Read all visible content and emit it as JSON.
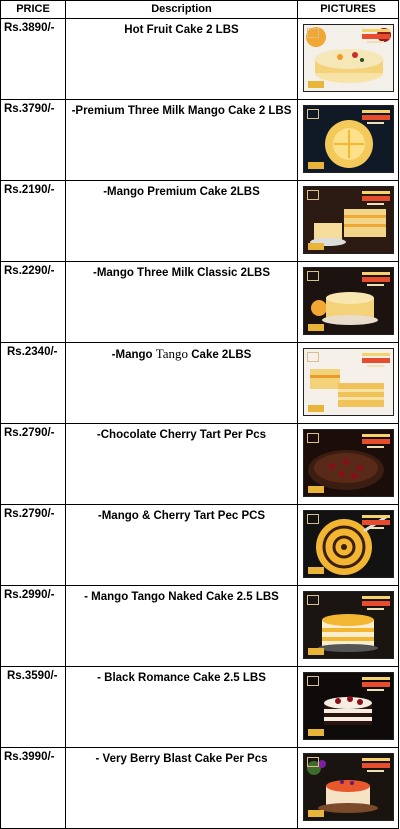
{
  "table": {
    "headers": {
      "price": "PRICE",
      "description": "Description",
      "pictures": "PICTURES"
    },
    "rows": [
      {
        "price": "Rs.3890/-",
        "description": "Hot Fruit Cake 2 LBS",
        "picture_icon": "cake-photo-icon"
      },
      {
        "price": "Rs.3790/-",
        "description": "-Premium Three Milk Mango Cake 2 LBS",
        "picture_icon": "cake-photo-icon"
      },
      {
        "price": "Rs.2190/-",
        "description": "-Mango Premium Cake  2LBS",
        "picture_icon": "cake-photo-icon"
      },
      {
        "price": "Rs.2290/-",
        "description": "-Mango Three Milk Classic 2LBS",
        "picture_icon": "cake-photo-icon"
      },
      {
        "price": "Rs.2340/-",
        "description_parts": [
          "-Mango ",
          "Tango",
          " Cake 2LBS"
        ],
        "picture_icon": "cake-photo-icon"
      },
      {
        "price": "Rs.2790/-",
        "description": "-Chocolate Cherry Tart  Per Pcs",
        "picture_icon": "tart-photo-icon"
      },
      {
        "price": "Rs.2790/-",
        "description": "-Mango & Cherry Tart Pec PCS",
        "picture_icon": "tart-photo-icon"
      },
      {
        "price": "Rs.2990/-",
        "description": "- Mango Tango Naked Cake 2.5 LBS",
        "picture_icon": "cake-photo-icon"
      },
      {
        "price": "Rs.3590/-",
        "description": "- Black Romance Cake 2.5 LBS",
        "picture_icon": "cake-photo-icon"
      },
      {
        "price": "Rs.3990/-",
        "description": "- Very Berry Blast Cake Per Pcs",
        "picture_icon": "cake-photo-icon"
      }
    ]
  },
  "colors": {
    "border": "#000000",
    "background": "#ffffff",
    "photo_dark": "#111111",
    "mango": "#f2b632",
    "cream": "#f6e7b8",
    "chocolate": "#3b1d12",
    "cherry": "#8b0d1a",
    "berry": "#e9572c"
  }
}
